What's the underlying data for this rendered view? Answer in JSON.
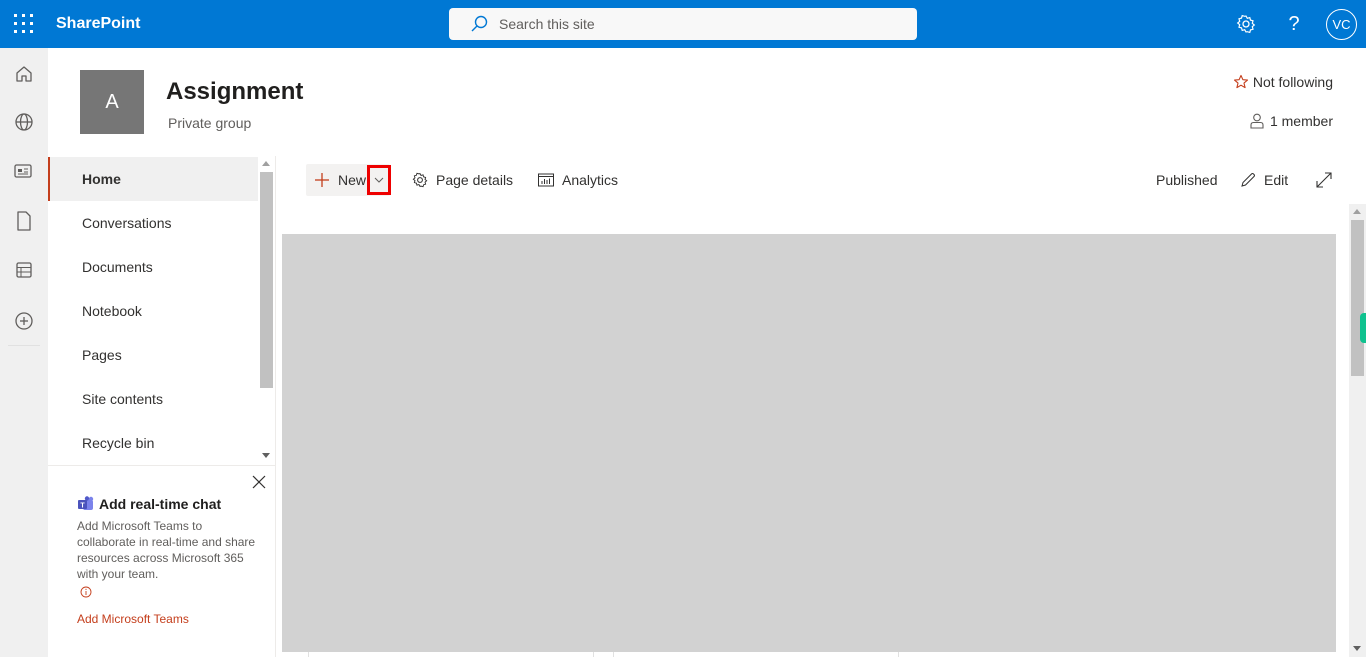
{
  "topbar": {
    "app_name": "SharePoint",
    "search_placeholder": "Search this site",
    "avatar_initials": "VC",
    "icons": [
      "waffle-icon",
      "search-icon",
      "settings-gear-icon",
      "help-icon"
    ]
  },
  "rail": {
    "items": [
      {
        "name": "home",
        "icon": "home-icon"
      },
      {
        "name": "sites",
        "icon": "globe-icon"
      },
      {
        "name": "news",
        "icon": "news-icon"
      },
      {
        "name": "files",
        "icon": "document-icon"
      },
      {
        "name": "lists",
        "icon": "list-icon"
      },
      {
        "name": "create",
        "icon": "add-circle-icon"
      }
    ]
  },
  "site": {
    "logo_letter": "A",
    "title": "Assignment",
    "subtitle": "Private group",
    "follow_label": "Not following",
    "members_label": "1 member"
  },
  "nav": {
    "items": [
      {
        "label": "Home",
        "selected": true
      },
      {
        "label": "Conversations",
        "selected": false
      },
      {
        "label": "Documents",
        "selected": false
      },
      {
        "label": "Notebook",
        "selected": false
      },
      {
        "label": "Pages",
        "selected": false
      },
      {
        "label": "Site contents",
        "selected": false
      },
      {
        "label": "Recycle bin",
        "selected": false
      }
    ]
  },
  "teams_promo": {
    "title": "Add real-time chat",
    "body": "Add Microsoft Teams to collaborate in real-time and share resources across Microsoft 365 with your team.",
    "link": "Add Microsoft Teams"
  },
  "commandbar": {
    "new_label": "New",
    "page_details_label": "Page details",
    "analytics_label": "Analytics",
    "status_label": "Published",
    "edit_label": "Edit"
  },
  "colors": {
    "brand": "#0078d4",
    "accent": "#c43e1c",
    "highlight_box": "#ee0000"
  }
}
